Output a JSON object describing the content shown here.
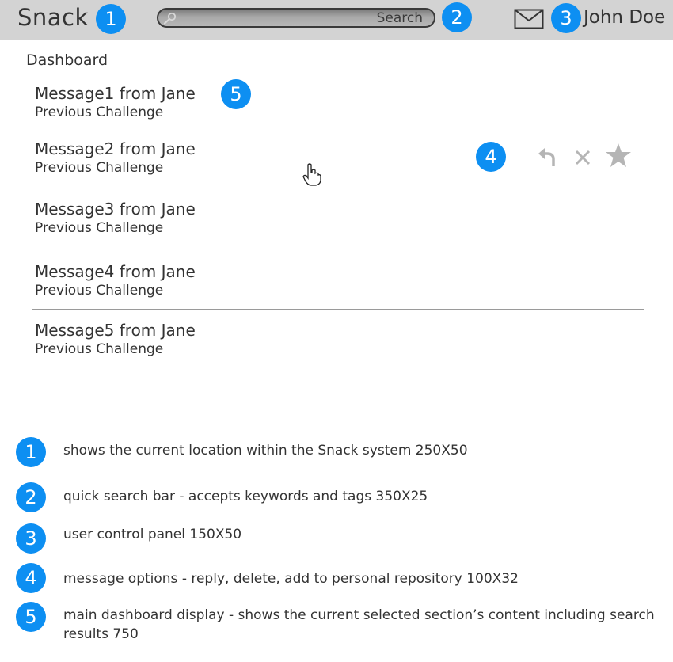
{
  "header": {
    "app_name": "Snack",
    "search_placeholder": "Search",
    "user_name": "John Doe"
  },
  "markers": [
    "1",
    "2",
    "3",
    "4",
    "5"
  ],
  "dashboard": {
    "title": "Dashboard",
    "messages": [
      {
        "title": "Message1 from Jane",
        "subtitle": "Previous Challenge"
      },
      {
        "title": "Message2 from Jane",
        "subtitle": "Previous Challenge"
      },
      {
        "title": "Message3 from Jane",
        "subtitle": "Previous Challenge"
      },
      {
        "title": "Message4 from Jane",
        "subtitle": "Previous Challenge"
      },
      {
        "title": "Message5 from Jane",
        "subtitle": "Previous Challenge"
      }
    ],
    "hovered_message_actions": [
      "reply-icon",
      "delete-icon",
      "star-icon"
    ]
  },
  "legend": [
    {
      "number": "1",
      "text": "shows the current location within the Snack system 250X50"
    },
    {
      "number": "2",
      "text": "quick search bar - accepts keywords and tags 350X25"
    },
    {
      "number": "3",
      "text": "user control panel 150X50"
    },
    {
      "number": "4",
      "text": "message options - reply, delete, add to personal repository  100X32"
    },
    {
      "number": "5",
      "text": "main dashboard display - shows the current selected section’s content including search results 750"
    }
  ],
  "colors": {
    "badge": "#0d8ff2",
    "topbar": "#d3d3d3",
    "icon_gray": "#b5b5b5"
  }
}
